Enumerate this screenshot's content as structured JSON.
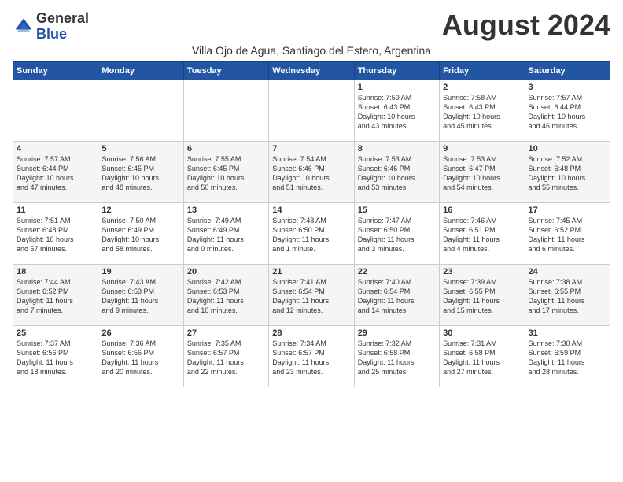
{
  "logo": {
    "general": "General",
    "blue": "Blue"
  },
  "title": "August 2024",
  "subtitle": "Villa Ojo de Agua, Santiago del Estero, Argentina",
  "days_of_week": [
    "Sunday",
    "Monday",
    "Tuesday",
    "Wednesday",
    "Thursday",
    "Friday",
    "Saturday"
  ],
  "weeks": [
    [
      {
        "num": "",
        "info": ""
      },
      {
        "num": "",
        "info": ""
      },
      {
        "num": "",
        "info": ""
      },
      {
        "num": "",
        "info": ""
      },
      {
        "num": "1",
        "info": "Sunrise: 7:59 AM\nSunset: 6:43 PM\nDaylight: 10 hours\nand 43 minutes."
      },
      {
        "num": "2",
        "info": "Sunrise: 7:58 AM\nSunset: 6:43 PM\nDaylight: 10 hours\nand 45 minutes."
      },
      {
        "num": "3",
        "info": "Sunrise: 7:57 AM\nSunset: 6:44 PM\nDaylight: 10 hours\nand 46 minutes."
      }
    ],
    [
      {
        "num": "4",
        "info": "Sunrise: 7:57 AM\nSunset: 6:44 PM\nDaylight: 10 hours\nand 47 minutes."
      },
      {
        "num": "5",
        "info": "Sunrise: 7:56 AM\nSunset: 6:45 PM\nDaylight: 10 hours\nand 48 minutes."
      },
      {
        "num": "6",
        "info": "Sunrise: 7:55 AM\nSunset: 6:45 PM\nDaylight: 10 hours\nand 50 minutes."
      },
      {
        "num": "7",
        "info": "Sunrise: 7:54 AM\nSunset: 6:46 PM\nDaylight: 10 hours\nand 51 minutes."
      },
      {
        "num": "8",
        "info": "Sunrise: 7:53 AM\nSunset: 6:46 PM\nDaylight: 10 hours\nand 53 minutes."
      },
      {
        "num": "9",
        "info": "Sunrise: 7:53 AM\nSunset: 6:47 PM\nDaylight: 10 hours\nand 54 minutes."
      },
      {
        "num": "10",
        "info": "Sunrise: 7:52 AM\nSunset: 6:48 PM\nDaylight: 10 hours\nand 55 minutes."
      }
    ],
    [
      {
        "num": "11",
        "info": "Sunrise: 7:51 AM\nSunset: 6:48 PM\nDaylight: 10 hours\nand 57 minutes."
      },
      {
        "num": "12",
        "info": "Sunrise: 7:50 AM\nSunset: 6:49 PM\nDaylight: 10 hours\nand 58 minutes."
      },
      {
        "num": "13",
        "info": "Sunrise: 7:49 AM\nSunset: 6:49 PM\nDaylight: 11 hours\nand 0 minutes."
      },
      {
        "num": "14",
        "info": "Sunrise: 7:48 AM\nSunset: 6:50 PM\nDaylight: 11 hours\nand 1 minute."
      },
      {
        "num": "15",
        "info": "Sunrise: 7:47 AM\nSunset: 6:50 PM\nDaylight: 11 hours\nand 3 minutes."
      },
      {
        "num": "16",
        "info": "Sunrise: 7:46 AM\nSunset: 6:51 PM\nDaylight: 11 hours\nand 4 minutes."
      },
      {
        "num": "17",
        "info": "Sunrise: 7:45 AM\nSunset: 6:52 PM\nDaylight: 11 hours\nand 6 minutes."
      }
    ],
    [
      {
        "num": "18",
        "info": "Sunrise: 7:44 AM\nSunset: 6:52 PM\nDaylight: 11 hours\nand 7 minutes."
      },
      {
        "num": "19",
        "info": "Sunrise: 7:43 AM\nSunset: 6:53 PM\nDaylight: 11 hours\nand 9 minutes."
      },
      {
        "num": "20",
        "info": "Sunrise: 7:42 AM\nSunset: 6:53 PM\nDaylight: 11 hours\nand 10 minutes."
      },
      {
        "num": "21",
        "info": "Sunrise: 7:41 AM\nSunset: 6:54 PM\nDaylight: 11 hours\nand 12 minutes."
      },
      {
        "num": "22",
        "info": "Sunrise: 7:40 AM\nSunset: 6:54 PM\nDaylight: 11 hours\nand 14 minutes."
      },
      {
        "num": "23",
        "info": "Sunrise: 7:39 AM\nSunset: 6:55 PM\nDaylight: 11 hours\nand 15 minutes."
      },
      {
        "num": "24",
        "info": "Sunrise: 7:38 AM\nSunset: 6:55 PM\nDaylight: 11 hours\nand 17 minutes."
      }
    ],
    [
      {
        "num": "25",
        "info": "Sunrise: 7:37 AM\nSunset: 6:56 PM\nDaylight: 11 hours\nand 18 minutes."
      },
      {
        "num": "26",
        "info": "Sunrise: 7:36 AM\nSunset: 6:56 PM\nDaylight: 11 hours\nand 20 minutes."
      },
      {
        "num": "27",
        "info": "Sunrise: 7:35 AM\nSunset: 6:57 PM\nDaylight: 11 hours\nand 22 minutes."
      },
      {
        "num": "28",
        "info": "Sunrise: 7:34 AM\nSunset: 6:57 PM\nDaylight: 11 hours\nand 23 minutes."
      },
      {
        "num": "29",
        "info": "Sunrise: 7:32 AM\nSunset: 6:58 PM\nDaylight: 11 hours\nand 25 minutes."
      },
      {
        "num": "30",
        "info": "Sunrise: 7:31 AM\nSunset: 6:58 PM\nDaylight: 11 hours\nand 27 minutes."
      },
      {
        "num": "31",
        "info": "Sunrise: 7:30 AM\nSunset: 6:59 PM\nDaylight: 11 hours\nand 28 minutes."
      }
    ]
  ]
}
